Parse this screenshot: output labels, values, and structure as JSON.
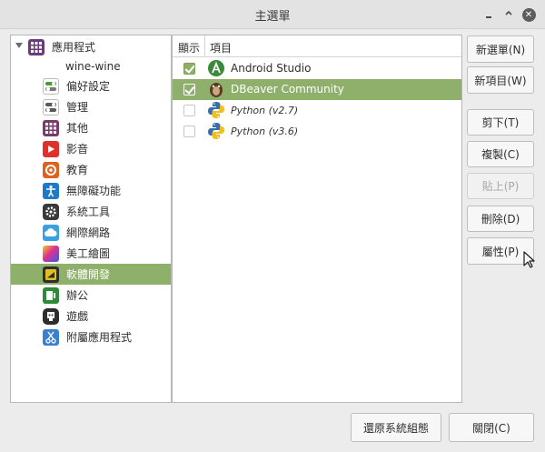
{
  "window": {
    "title": "主選單"
  },
  "tree": {
    "items": [
      {
        "label": "應用程式",
        "icon": "grid-apps-icon",
        "color": "#6b3a7a"
      },
      {
        "label": "wine-wine",
        "icon": "",
        "color": ""
      },
      {
        "label": "偏好設定",
        "icon": "preferences-toggle-icon",
        "color": "#3a7a3a"
      },
      {
        "label": "管理",
        "icon": "admin-toggle-icon",
        "color": "#5a5a5a"
      },
      {
        "label": "其他",
        "icon": "other-grid-icon",
        "color": "#7a3a6b"
      },
      {
        "label": "影音",
        "icon": "play-icon",
        "color": "#e0302c"
      },
      {
        "label": "教育",
        "icon": "education-gear-icon",
        "color": "#e06020"
      },
      {
        "label": "無障礙功能",
        "icon": "accessibility-person-icon",
        "color": "#1e7ac8"
      },
      {
        "label": "系統工具",
        "icon": "system-gear-icon",
        "color": "#3a3a3a"
      },
      {
        "label": "網際網路",
        "icon": "cloud-icon",
        "color": "#3aa0e0"
      },
      {
        "label": "美工繪圖",
        "icon": "graphics-palette-icon",
        "color": "#e03090"
      },
      {
        "label": "軟體開發",
        "icon": "development-icon",
        "color": "#e0c020"
      },
      {
        "label": "辦公",
        "icon": "office-doc-icon",
        "color": "#2e8a3a"
      },
      {
        "label": "遊戲",
        "icon": "gamepad-icon",
        "color": "#2e2e2e"
      },
      {
        "label": "附屬應用程式",
        "icon": "scissors-icon",
        "color": "#3a80d0"
      }
    ],
    "selected_index": 11
  },
  "list": {
    "columns": {
      "show": "顯示",
      "item": "項目"
    },
    "rows": [
      {
        "name": "Android Studio",
        "checked": true,
        "icon": "android-studio-icon",
        "italic": false
      },
      {
        "name": "DBeaver Community",
        "checked": true,
        "icon": "dbeaver-icon",
        "italic": false
      },
      {
        "name": "Python (v2.7)",
        "checked": false,
        "icon": "python-icon",
        "italic": true
      },
      {
        "name": "Python (v3.6)",
        "checked": false,
        "icon": "python-icon",
        "italic": true
      }
    ],
    "selected_index": 1
  },
  "buttons": {
    "new_menu": "新選單(N)",
    "new_item": "新項目(W)",
    "cut": "剪下(T)",
    "copy": "複製(C)",
    "paste": "貼上(P)",
    "delete": "刪除(D)",
    "properties": "屬性(P)",
    "restore": "還原系統組態",
    "close": "關閉(C)"
  },
  "colors": {
    "selection": "#8fb06b"
  }
}
